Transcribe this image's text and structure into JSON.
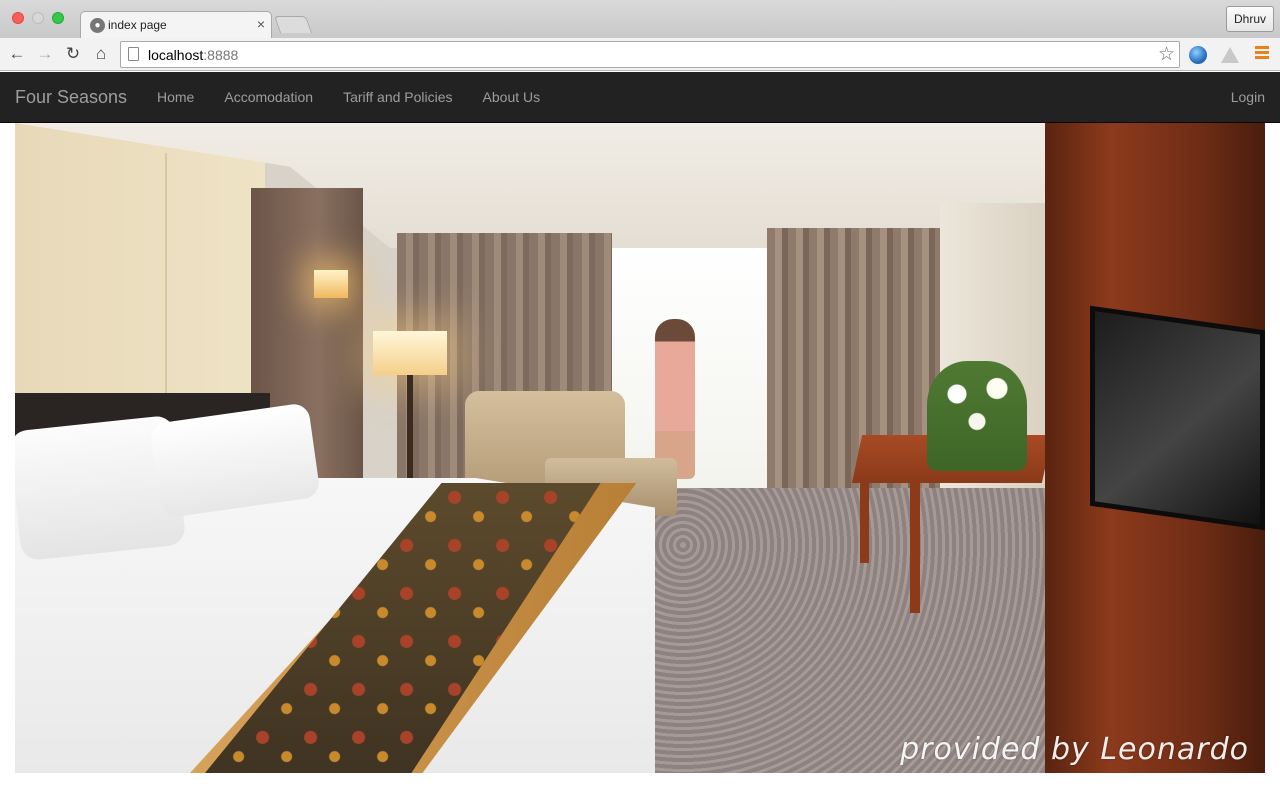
{
  "browser": {
    "tab_title": "index page",
    "tab_close_symbol": "×",
    "profile_name": "Dhruv",
    "url_host": "localhost",
    "url_port": ":8888",
    "icons": [
      "back-icon",
      "forward-icon",
      "reload-icon",
      "home-icon",
      "page-icon",
      "star-icon",
      "globe-extension-icon",
      "drive-extension-icon",
      "menu-icon"
    ]
  },
  "navbar": {
    "brand": "Four Seasons",
    "links": [
      {
        "label": "Home"
      },
      {
        "label": "Accomodation"
      },
      {
        "label": "Tariff and Policies"
      },
      {
        "label": "About Us"
      }
    ],
    "login": "Login",
    "background_color": "#222222",
    "text_color": "#9d9d9d"
  },
  "hero": {
    "watermark": "provided by Leonardo"
  }
}
